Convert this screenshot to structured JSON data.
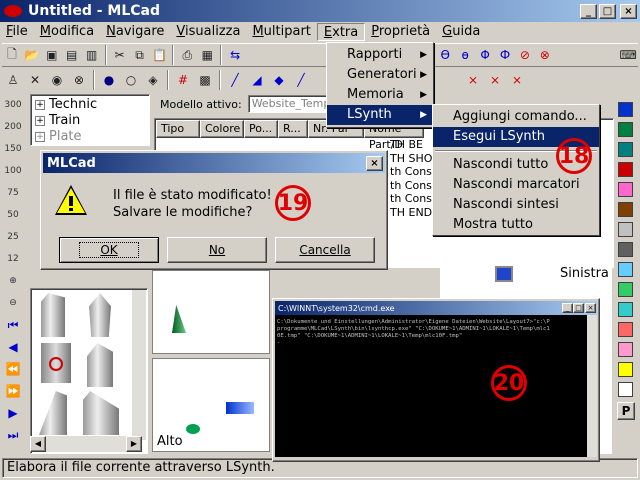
{
  "window": {
    "title": "Untitled - MLCad",
    "min": "_",
    "max": "□",
    "close": "×"
  },
  "menubar": [
    {
      "label": "File",
      "key": "F"
    },
    {
      "label": "Modifica",
      "key": "M"
    },
    {
      "label": "Navigare",
      "key": "N"
    },
    {
      "label": "Visualizza",
      "key": "V"
    },
    {
      "label": "Multipart",
      "key": "M"
    },
    {
      "label": "Extra",
      "key": "E"
    },
    {
      "label": "Proprietà",
      "key": "P"
    },
    {
      "label": "Guida",
      "key": "G"
    }
  ],
  "extra_menu": [
    "Rapporti",
    "Generatori",
    "Memoria",
    "LSynth"
  ],
  "lsynth_menu": [
    "Aggiungi comando...",
    "Esegui LSynth",
    "Nascondi tutto",
    "Nascondi marcatori",
    "Nascondi sintesi",
    "Mostra tutto"
  ],
  "tree": [
    "Technic",
    "Train",
    "Plate"
  ],
  "tree_expander": "+",
  "model_label": "Modello attivo:",
  "model_value": "Website_Templ",
  "columns": [
    "Tipo",
    "Colore",
    "Po...",
    "R...",
    "Nr. Par",
    "Nome Part/D"
  ],
  "cmd_rows": [
    "TH BE",
    "TH SHO",
    "th Cons",
    "th Cons",
    "th Cons",
    "TH END"
  ],
  "dialog": {
    "title": "MLCad",
    "close": "×",
    "message1": "Il file è stato modificato!",
    "message2": "Salvare le modifiche?",
    "ok": "OK",
    "no": "No",
    "cancel": "Cancella"
  },
  "callouts": {
    "n18": "18",
    "n19": "19",
    "n20": "20"
  },
  "view_labels": {
    "left": "Sinistra",
    "top": "Alto"
  },
  "cmd": {
    "title": "C:\\WINNT\\system32\\cmd.exe",
    "lines": [
      "C:\\Dokumente und Einstellungen\\Administrator\\Eigene Dateien\\Website\\Layout7>\"c:\\P",
      "programme\\MLCad\\LSynth\\bin\\lsynthcp.exe\" \"C:\\DOKUME~1\\ADMINI~1\\LOKALE~1\\Temp\\mlc1",
      "0E.tmp\" \"C:\\DOKUME~1\\ADMINI~1\\LOKALE~1\\Temp\\mlc10F.tmp\"",
      "-"
    ]
  },
  "status": "Elabora il file corrente attraverso LSynth.",
  "palette_letter": "P",
  "colors": {
    "accent": "#0a246a",
    "callout": "#e00000",
    "swatches": [
      "#0033cc",
      "#008040",
      "#008080",
      "#cc0000",
      "#ff66cc",
      "#804000",
      "#c0c0c0",
      "#606060",
      "#66ccff",
      "#33cc66",
      "#33cccc",
      "#ff6666",
      "#ff99cc",
      "#ffff00",
      "#ffffff"
    ]
  }
}
